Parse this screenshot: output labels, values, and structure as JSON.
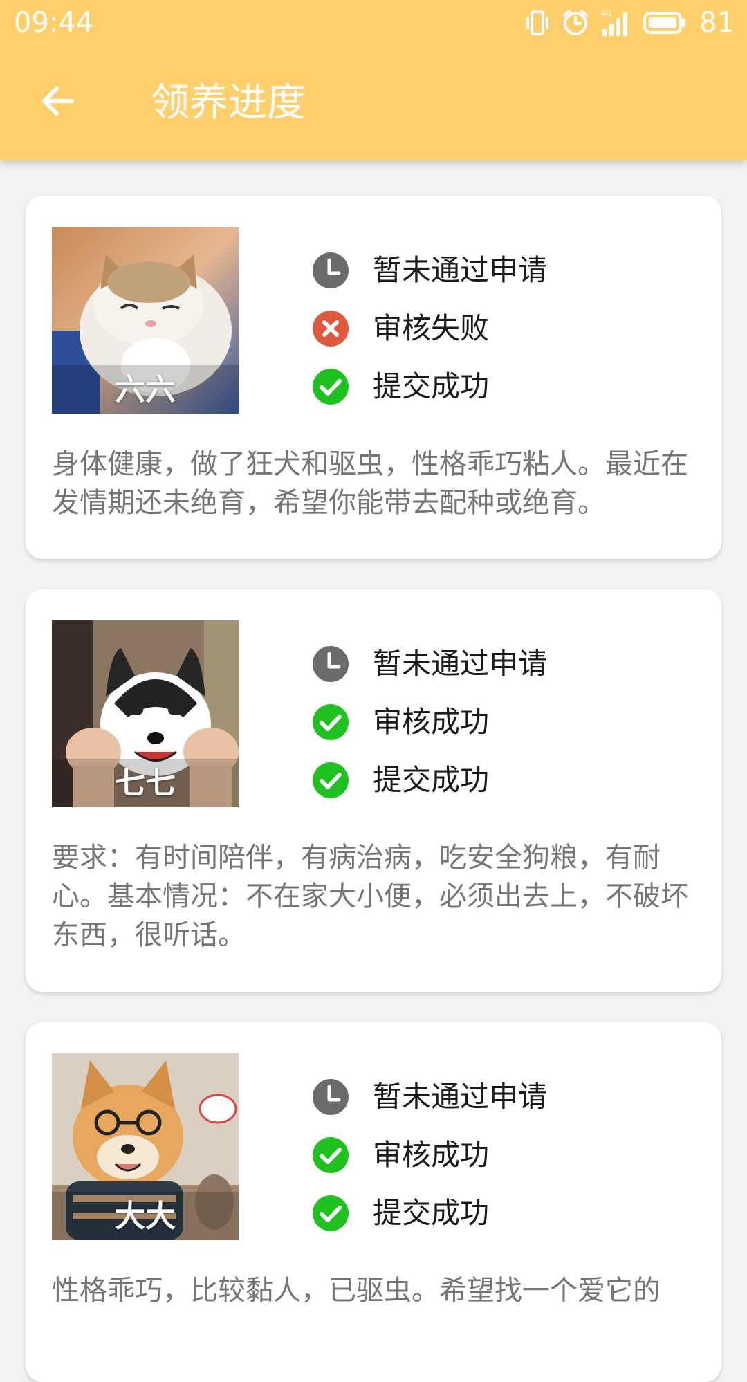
{
  "status_bar": {
    "time": "09:44",
    "battery": "81",
    "icons": [
      "vibrate-icon",
      "alarm-icon",
      "signal-4g-icon",
      "battery-icon"
    ]
  },
  "toolbar": {
    "title": "领养进度",
    "back_icon": "arrow-left-icon"
  },
  "colors": {
    "appbar": "#fecf6b",
    "pending": "#6b6b6b",
    "failed": "#e0593f",
    "success": "#1fc11f"
  },
  "cards": [
    {
      "pet_name": "六六",
      "statuses": [
        {
          "icon": "clock-icon",
          "text": "暂未通过申请"
        },
        {
          "icon": "error-icon",
          "text": "审核失败"
        },
        {
          "icon": "check-icon",
          "text": "提交成功"
        }
      ],
      "description": "身体健康，做了狂犬和驱虫，性格乖巧粘人。最近在发情期还未绝育，希望你能带去配种或绝育。"
    },
    {
      "pet_name": "七七",
      "statuses": [
        {
          "icon": "clock-icon",
          "text": "暂未通过申请"
        },
        {
          "icon": "check-icon",
          "text": "审核成功"
        },
        {
          "icon": "check-icon",
          "text": "提交成功"
        }
      ],
      "description": "要求：有时间陪伴，有病治病，吃安全狗粮，有耐心。基本情况：不在家大小便，必须出去上，不破坏东西，很听话。"
    },
    {
      "pet_name": "大大",
      "statuses": [
        {
          "icon": "clock-icon",
          "text": "暂未通过申请"
        },
        {
          "icon": "check-icon",
          "text": "审核成功"
        },
        {
          "icon": "check-icon",
          "text": "提交成功"
        }
      ],
      "description": "性格乖巧，比较黏人，已驱虫。希望找一个爱它的"
    }
  ]
}
